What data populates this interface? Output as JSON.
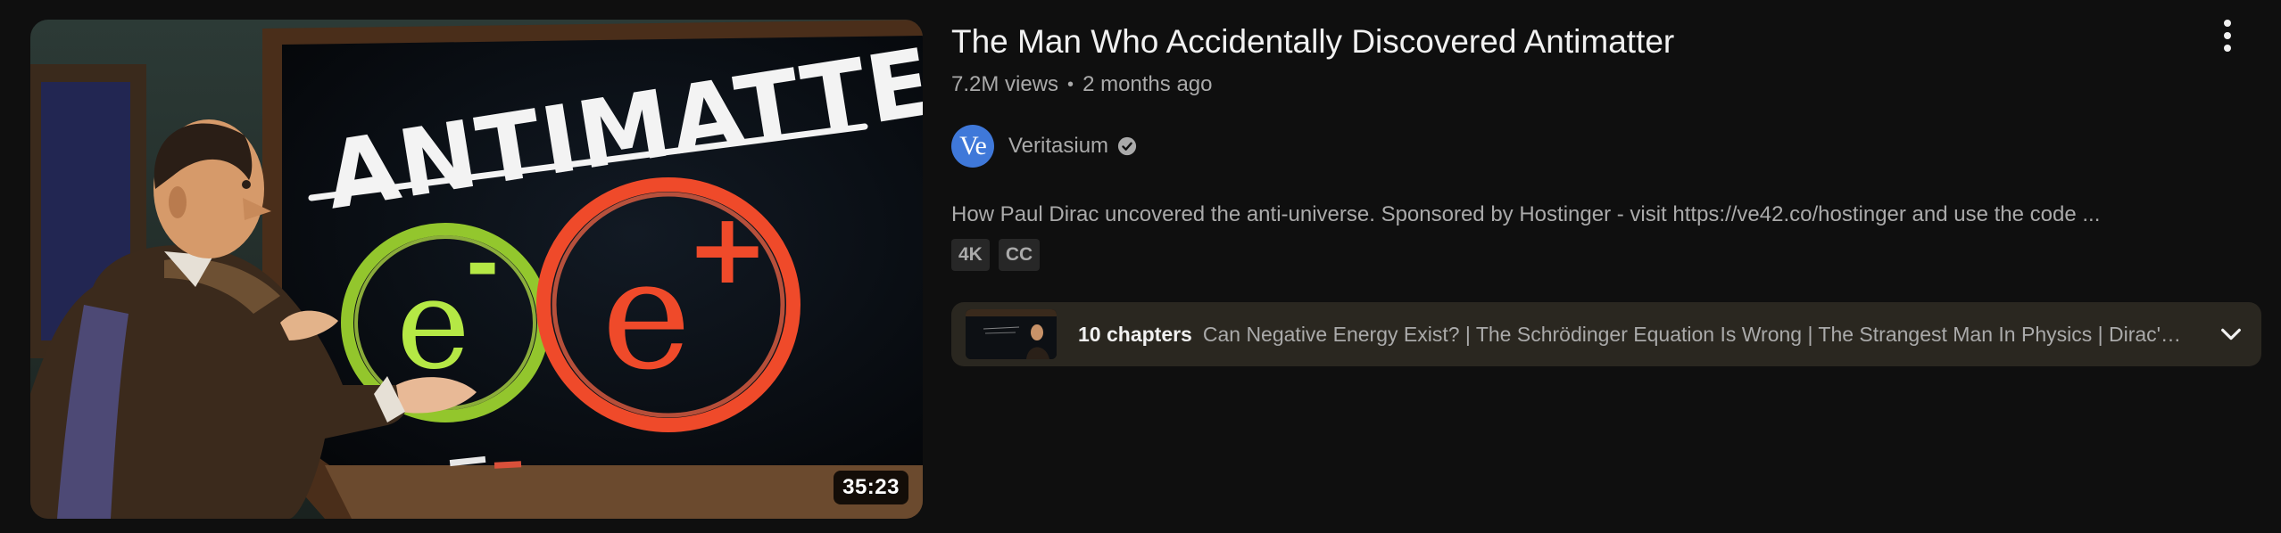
{
  "video": {
    "title": "The Man Who Accidentally Discovered Antimatter",
    "views": "7.2M views",
    "age": "2 months ago",
    "duration": "35:23",
    "description": "How Paul Dirac uncovered the anti-universe. Sponsored by Hostinger - visit https://ve42.co/hostinger and use the code ...",
    "badges": [
      "4K",
      "CC"
    ],
    "thumbnail_text": {
      "headline": "ANTIMATTER",
      "electron": "e",
      "electron_sign": "-",
      "positron": "e",
      "positron_sign": "+"
    }
  },
  "channel": {
    "name": "Veritasium",
    "avatar_text": "Ve",
    "verified_icon": "verified-check-icon",
    "avatar_color": "#3f78d9"
  },
  "chapters": {
    "count_label": "10 chapters",
    "list_text": "Can Negative Energy Exist? | The Schrödinger Equation Is Wrong | The Strangest Man In Physics | Dirac's Equation | Holes",
    "expand_icon": "chevron-down-icon"
  },
  "menu": {
    "icon": "more-vert-icon"
  },
  "colors": {
    "background": "#0f0f0f",
    "primary_text": "#f1f1f1",
    "secondary_text": "#aaaaaa",
    "badge_bg": "#272727",
    "chapters_bg": "#2a2720"
  }
}
